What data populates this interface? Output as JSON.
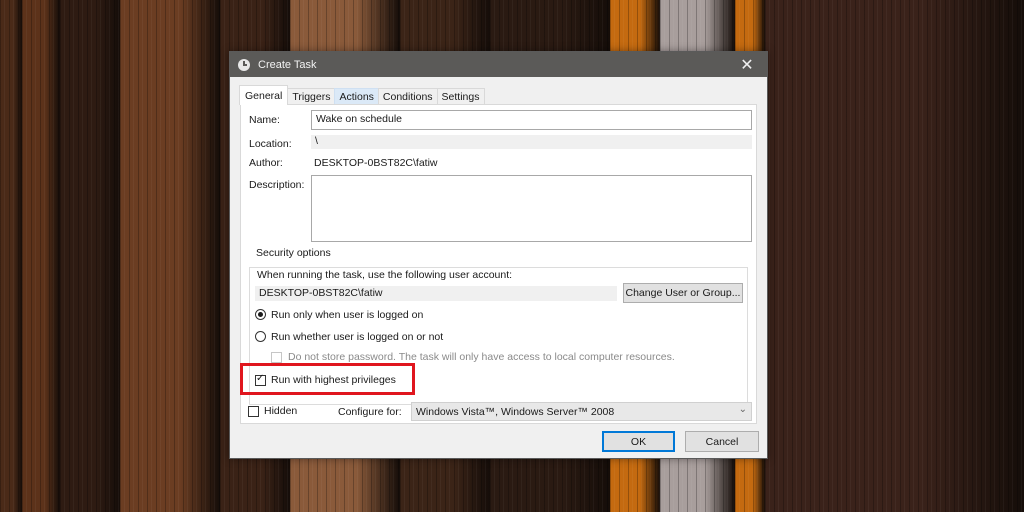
{
  "background": {
    "description": "wooden plank wallpaper",
    "planks": [
      {
        "color": "#4a2a18"
      },
      {
        "color": "#5c321a"
      },
      {
        "color": "#2e1b12"
      },
      {
        "color": "#6b3d22"
      },
      {
        "color": "#3a2216"
      },
      {
        "color": "#8a5a3a"
      },
      {
        "color": "#3b2417"
      },
      {
        "color": "#2a1a12"
      },
      {
        "color": "#c46a10"
      },
      {
        "color": "#a89e9c"
      },
      {
        "color": "#c46a10"
      },
      {
        "color": "#3a221a"
      }
    ]
  },
  "window": {
    "title": "Create Task",
    "icon": "task-scheduler-clock-icon",
    "close_icon": "✕"
  },
  "tabs": [
    {
      "label": "General",
      "active": true
    },
    {
      "label": "Triggers",
      "active": false
    },
    {
      "label": "Actions",
      "active": false,
      "hover": true
    },
    {
      "label": "Conditions",
      "active": false
    },
    {
      "label": "Settings",
      "active": false
    }
  ],
  "general": {
    "name_label": "Name:",
    "name_value": "Wake on schedule",
    "location_label": "Location:",
    "location_value": "\\",
    "author_label": "Author:",
    "author_value": "DESKTOP-0BST82C\\fatiw",
    "description_label": "Description:",
    "description_value": ""
  },
  "security": {
    "group_title": "Security options",
    "account_prompt": "When running the task, use the following user account:",
    "account_value": "DESKTOP-0BST82C\\fatiw",
    "change_user_button": "Change User or Group...",
    "radio_logged_on": {
      "label": "Run only when user is logged on",
      "checked": true
    },
    "radio_whether": {
      "label": "Run whether user is logged on or not",
      "checked": false
    },
    "do_not_store": {
      "label": "Do not store password.  The task will only have access to local computer resources.",
      "checked": false,
      "disabled": true
    },
    "highest_privileges": {
      "label": "Run with highest privileges",
      "checked": true,
      "highlighted": true
    }
  },
  "footer_options": {
    "hidden": {
      "label": "Hidden",
      "checked": false
    },
    "configure_label": "Configure for:",
    "configure_value": "Windows Vista™, Windows Server™ 2008"
  },
  "buttons": {
    "ok": "OK",
    "cancel": "Cancel"
  },
  "colors": {
    "highlight_red": "#e0161e",
    "accent_blue": "#0078d7",
    "titlebar": "#5b5a58"
  }
}
